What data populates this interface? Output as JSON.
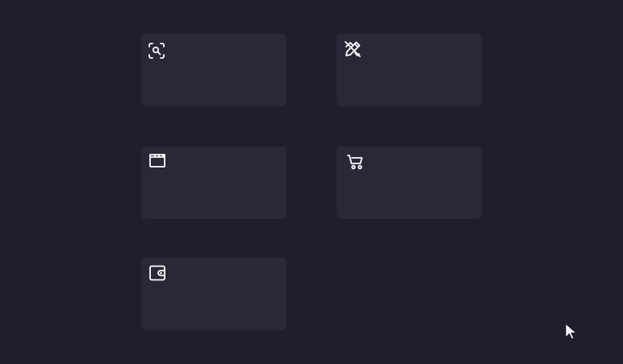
{
  "theme": {
    "background": "#201e2d",
    "card_background": "#2a2837",
    "icon_color": "#ffffff"
  },
  "cards": [
    {
      "icon": "scan-search-icon"
    },
    {
      "icon": "pencil-ruler-off-icon"
    },
    {
      "icon": "clapperboard-icon"
    },
    {
      "icon": "shopping-cart-icon"
    },
    {
      "icon": "wallet-icon"
    }
  ],
  "cursor": {
    "icon": "mouse-pointer-icon"
  }
}
